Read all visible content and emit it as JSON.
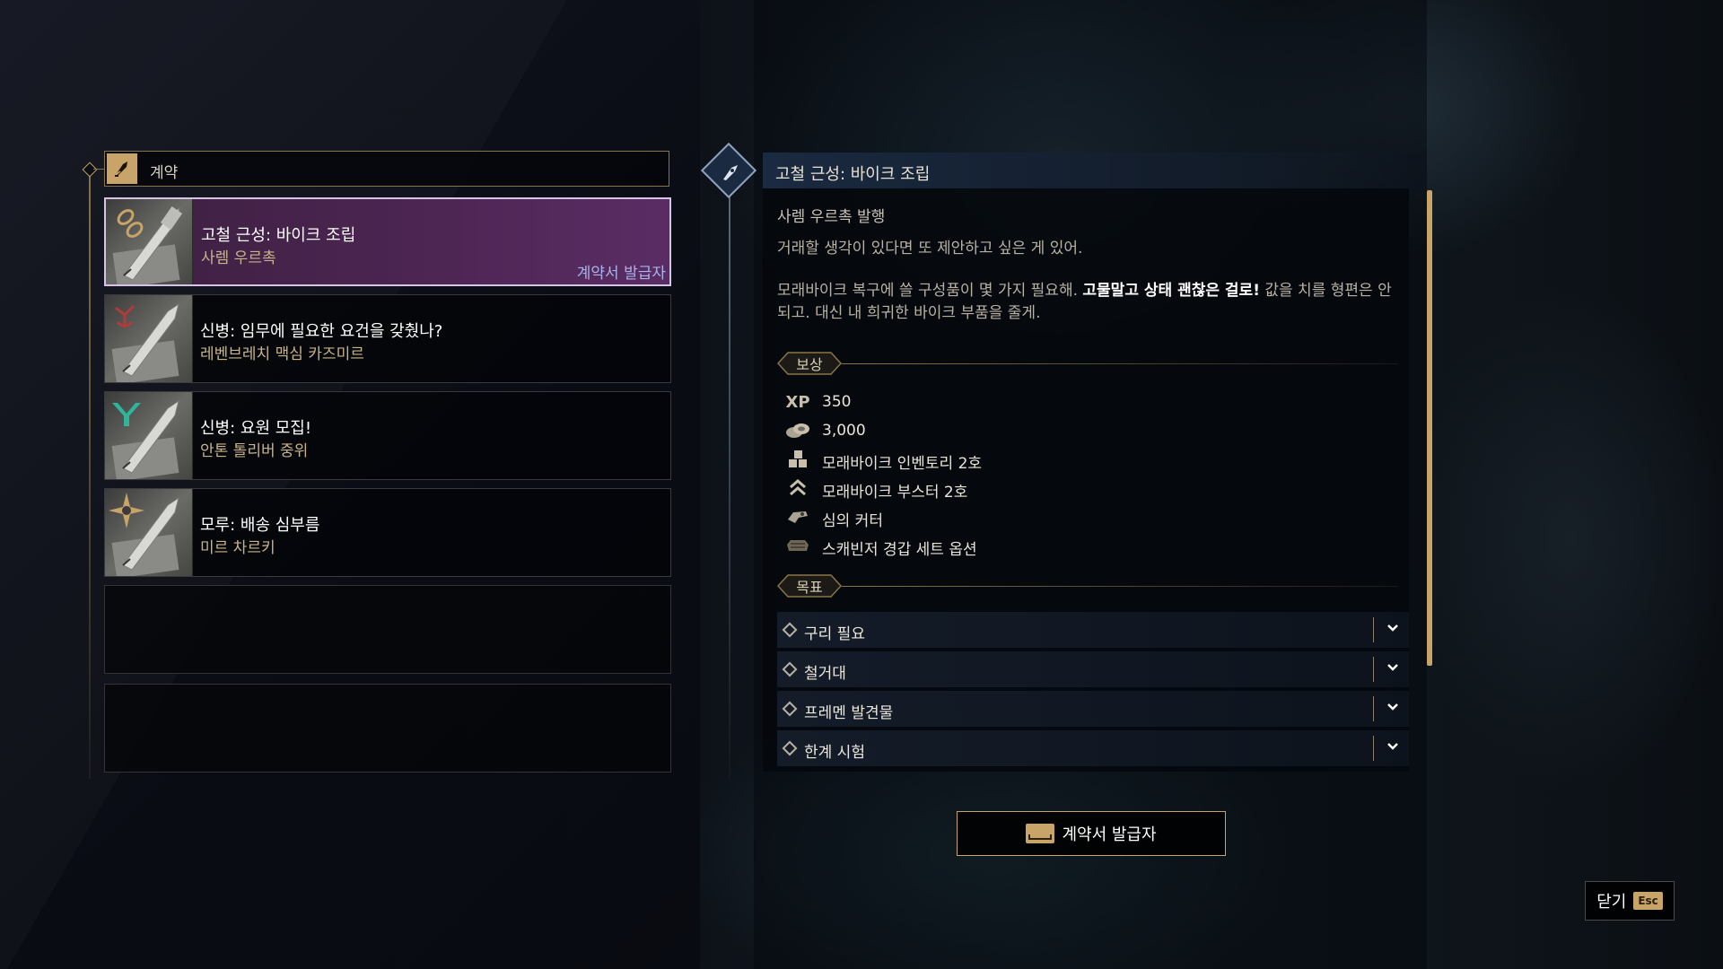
{
  "list": {
    "header": "계약",
    "entries": [
      {
        "title": "고철 근성: 바이크 조립",
        "subtitle": "사렘 우르촉",
        "tag": "계약서 발급자",
        "selected": true,
        "icon": "chain-quill-icon",
        "accent": "#c8a468"
      },
      {
        "title": "신병: 임무에 필요한 요건을 갖췄나?",
        "subtitle": "레벤브레치 맥심 카즈미르",
        "icon": "red-emblem-quill-icon",
        "accent": "#b23a3a"
      },
      {
        "title": "신병: 요원 모집!",
        "subtitle": "안톤 톨리버 중위",
        "icon": "green-emblem-quill-icon",
        "accent": "#2fb59a"
      },
      {
        "title": "모루: 배송 심부름",
        "subtitle": "미르 차르키",
        "icon": "compass-emblem-quill-icon",
        "accent": "#c8a468"
      }
    ]
  },
  "detail": {
    "title": "고철 근성: 바이크 조립",
    "issuer": "사렘 우르촉 발행",
    "desc1": "거래할 생각이 있다면 또 제안하고 싶은 게 있어.",
    "desc2_a": "모래바이크 복구에 쓸 구성품이 몇 가지 필요해.",
    "desc2_highlight": "고물말고 상태 괜찮은 걸로!",
    "desc2_b": "값을 치를 형편은 안 되고. 대신 내 희귀한 바이크 부품을 줄게.",
    "rewards_label": "보상",
    "rewards": [
      {
        "icon": "xp-icon",
        "icon_text": "XP",
        "label": "350"
      },
      {
        "icon": "solari-coins-icon",
        "label": "3,000"
      },
      {
        "icon": "crates-icon",
        "label": "모래바이크 인벤토리 2호"
      },
      {
        "icon": "booster-chevrons-icon",
        "label": "모래바이크 부스터 2호"
      },
      {
        "icon": "cutter-icon",
        "label": "심의 커터"
      },
      {
        "icon": "armor-set-icon",
        "label": "스캐빈저 경갑 세트 옵션"
      }
    ],
    "goals_label": "목표",
    "goals": [
      {
        "label": "구리 필요"
      },
      {
        "label": "철거대"
      },
      {
        "label": "프레멘 발견물"
      },
      {
        "label": "한계 시험"
      }
    ]
  },
  "issuer_button": "계약서 발급자",
  "close_button": {
    "label": "닫기",
    "key": "Esc"
  }
}
